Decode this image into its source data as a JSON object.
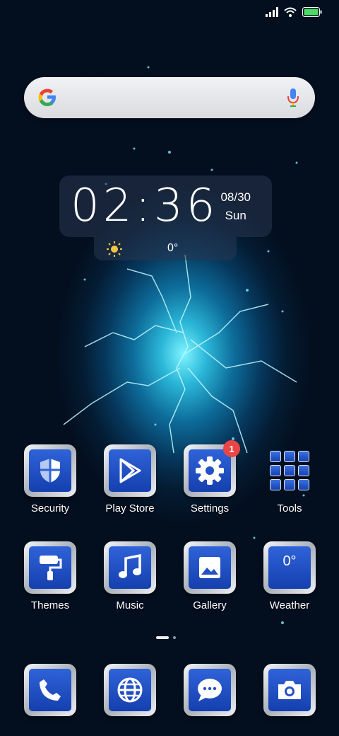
{
  "clock": {
    "time": "02:36",
    "date": "08/30",
    "day": "Sun"
  },
  "weather_widget": {
    "temp": "0°"
  },
  "apps": [
    {
      "label": "Security",
      "icon": "shield-icon"
    },
    {
      "label": "Play Store",
      "icon": "play-store-icon"
    },
    {
      "label": "Settings",
      "icon": "gear-icon",
      "badge": "1"
    },
    {
      "label": "Tools",
      "icon": "folder-icon"
    },
    {
      "label": "Themes",
      "icon": "paint-roller-icon"
    },
    {
      "label": "Music",
      "icon": "music-note-icon"
    },
    {
      "label": "Gallery",
      "icon": "image-icon"
    },
    {
      "label": "Weather",
      "icon": "weather-icon",
      "value": "0°"
    }
  ],
  "dock": [
    {
      "icon": "phone-icon"
    },
    {
      "icon": "globe-icon"
    },
    {
      "icon": "message-icon"
    },
    {
      "icon": "camera-icon"
    }
  ],
  "colors": {
    "tile_blue": "#2f63d8",
    "badge": "#e94545",
    "battery": "#4cd964"
  }
}
